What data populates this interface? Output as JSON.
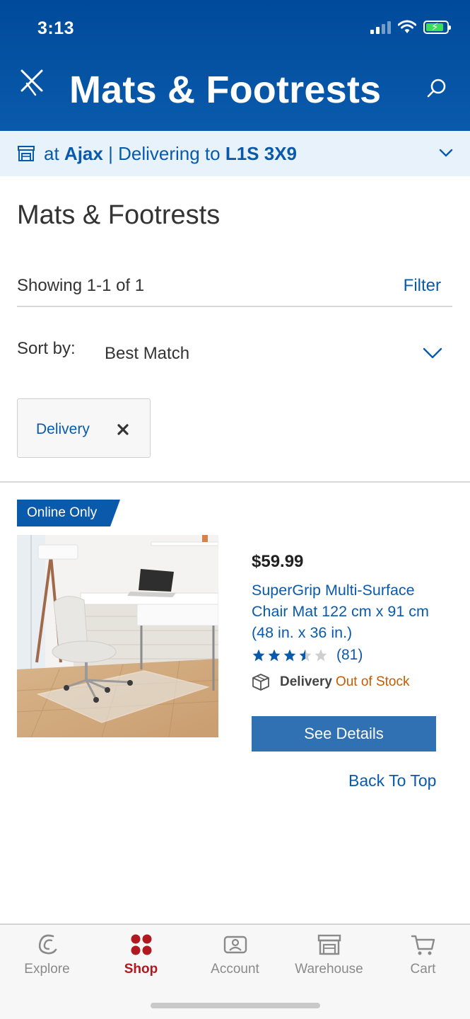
{
  "status_bar": {
    "time": "3:13"
  },
  "header": {
    "title": "Mats & Footrests"
  },
  "location": {
    "prefix": "at",
    "store": "Ajax",
    "separator": "|",
    "delivering_label": "Delivering to",
    "postal_code": "L1S 3X9"
  },
  "page": {
    "title": "Mats & Footrests"
  },
  "results": {
    "count_text": "Showing 1-1 of 1",
    "filter_label": "Filter"
  },
  "sort": {
    "label": "Sort by:",
    "value": "Best Match"
  },
  "active_filters": [
    {
      "label": "Delivery"
    }
  ],
  "products": [
    {
      "badge": "Online Only",
      "price": "$59.99",
      "name": "SuperGrip Multi-Surface Chair Mat 122 cm x 91 cm (48 in. x 36 in.)",
      "rating": 3.5,
      "rating_max": 5,
      "review_count": "(81)",
      "delivery_label": "Delivery",
      "stock_status": "Out of Stock",
      "cta_label": "See Details"
    }
  ],
  "back_to_top": "Back To Top",
  "tabbar": {
    "tabs": [
      {
        "label": "Explore",
        "icon": "explore-icon"
      },
      {
        "label": "Shop",
        "icon": "shop-icon",
        "active": true
      },
      {
        "label": "Account",
        "icon": "account-icon"
      },
      {
        "label": "Warehouse",
        "icon": "warehouse-icon"
      },
      {
        "label": "Cart",
        "icon": "cart-icon"
      }
    ]
  },
  "colors": {
    "brand_blue": "#004a9b",
    "link_blue": "#0a5aab",
    "button_blue": "#3071b3",
    "active_red": "#b0191f",
    "out_of_stock": "#c75b00"
  }
}
